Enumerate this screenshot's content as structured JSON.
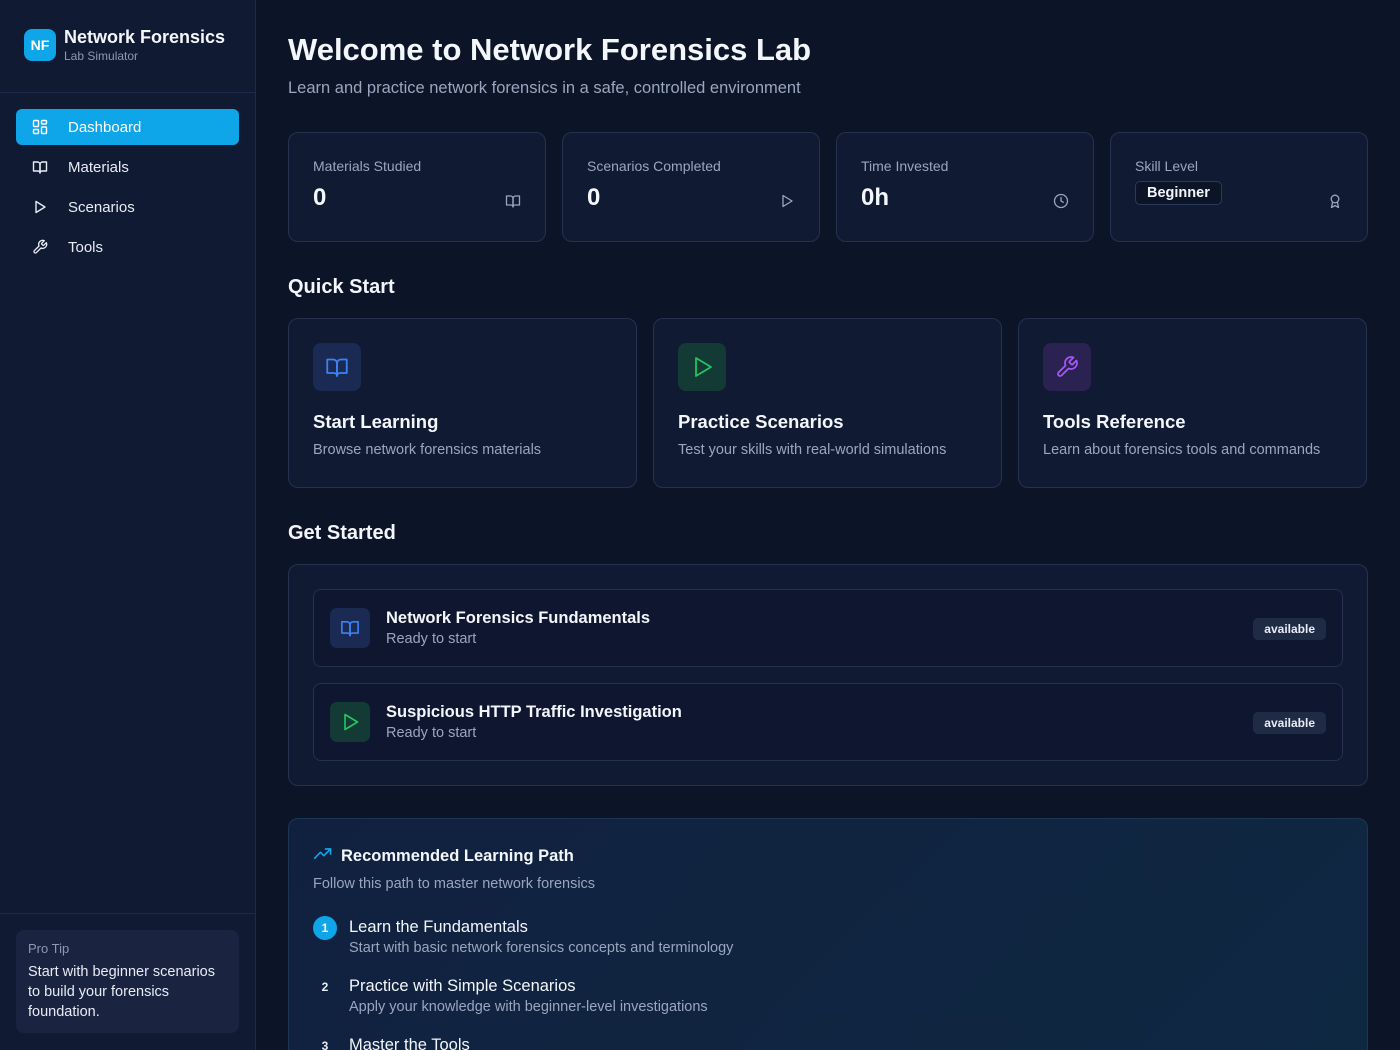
{
  "brand": {
    "logo": "NF",
    "title": "Network Forensics",
    "subtitle": "Lab Simulator"
  },
  "nav": [
    {
      "label": "Dashboard",
      "icon": "dashboard-icon",
      "active": true
    },
    {
      "label": "Materials",
      "icon": "book-icon"
    },
    {
      "label": "Scenarios",
      "icon": "play-icon"
    },
    {
      "label": "Tools",
      "icon": "wrench-icon"
    }
  ],
  "tip": {
    "label": "Pro Tip",
    "text": "Start with beginner scenarios to build your forensics foundation."
  },
  "header": {
    "title": "Welcome to Network Forensics Lab",
    "subtitle": "Learn and practice network forensics in a safe, controlled environment"
  },
  "stats": [
    {
      "label": "Materials Studied",
      "value": "0",
      "icon": "book-icon"
    },
    {
      "label": "Scenarios Completed",
      "value": "0",
      "icon": "play-icon"
    },
    {
      "label": "Time Invested",
      "value": "0h",
      "icon": "clock-icon"
    },
    {
      "label": "Skill Level",
      "value": "Beginner",
      "icon": "award-icon"
    }
  ],
  "quick_start": {
    "title": "Quick Start",
    "cards": [
      {
        "title": "Start Learning",
        "desc": "Browse network forensics materials",
        "icon": "book-icon",
        "color": "#3b82f6"
      },
      {
        "title": "Practice Scenarios",
        "desc": "Test your skills with real-world simulations",
        "icon": "play-icon",
        "color": "#22c55e"
      },
      {
        "title": "Tools Reference",
        "desc": "Learn about forensics tools and commands",
        "icon": "wrench-icon",
        "color": "#a855f7"
      }
    ]
  },
  "get_started": {
    "title": "Get Started",
    "items": [
      {
        "title": "Network Forensics Fundamentals",
        "status": "Ready to start",
        "badge": "available",
        "icon": "book-icon"
      },
      {
        "title": "Suspicious HTTP Traffic Investigation",
        "status": "Ready to start",
        "badge": "available",
        "icon": "play-icon"
      }
    ]
  },
  "learning_path": {
    "title": "Recommended Learning Path",
    "subtitle": "Follow this path to master network forensics",
    "steps": [
      {
        "num": "1",
        "title": "Learn the Fundamentals",
        "desc": "Start with basic network forensics concepts and terminology"
      },
      {
        "num": "2",
        "title": "Practice with Simple Scenarios",
        "desc": "Apply your knowledge with beginner-level investigations"
      },
      {
        "num": "3",
        "title": "Master the Tools",
        "desc": ""
      }
    ]
  },
  "colors": {
    "accent": "#0ea5e9",
    "background": "#0c1427",
    "sidebar": "#111a33"
  }
}
